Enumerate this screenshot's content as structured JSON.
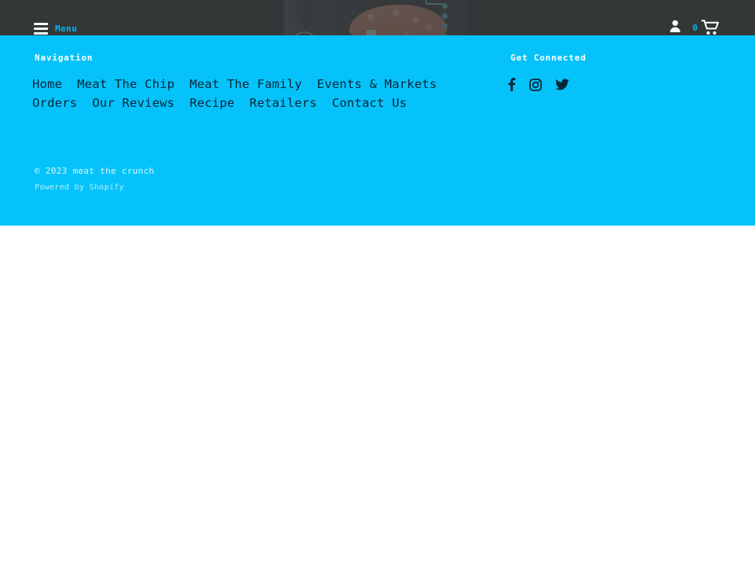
{
  "header": {
    "menu_label": "Menu",
    "hamburger_icon": "hamburger-menu-icon",
    "account_icon": "person-icon",
    "cart_icon": "shopping-cart-icon",
    "cart_count": "0",
    "accent_color": "#00b7f0",
    "bar_color": "#5a6062"
  },
  "hero": {
    "alt": "product pouch with ground meat patty"
  },
  "footer": {
    "background_color": "#05c3fa",
    "navigation": {
      "heading": "Navigation",
      "links": [
        {
          "label": "Home"
        },
        {
          "label": "Meat The Chip"
        },
        {
          "label": "Meat The Family"
        },
        {
          "label": "Events & Markets"
        },
        {
          "label": "Orders"
        },
        {
          "label": "Our Reviews"
        },
        {
          "label": "Recipe"
        },
        {
          "label": "Retailers"
        },
        {
          "label": "Contact Us"
        }
      ]
    },
    "social": {
      "heading": "Get Connected",
      "links": [
        {
          "name": "facebook",
          "icon": "facebook-icon"
        },
        {
          "name": "instagram",
          "icon": "instagram-icon"
        },
        {
          "name": "twitter",
          "icon": "twitter-icon"
        }
      ]
    },
    "legal": {
      "copyright": "© 2023 meat the crunch",
      "powered_prefix": "Powered by ",
      "powered_link": "Shopify"
    }
  }
}
